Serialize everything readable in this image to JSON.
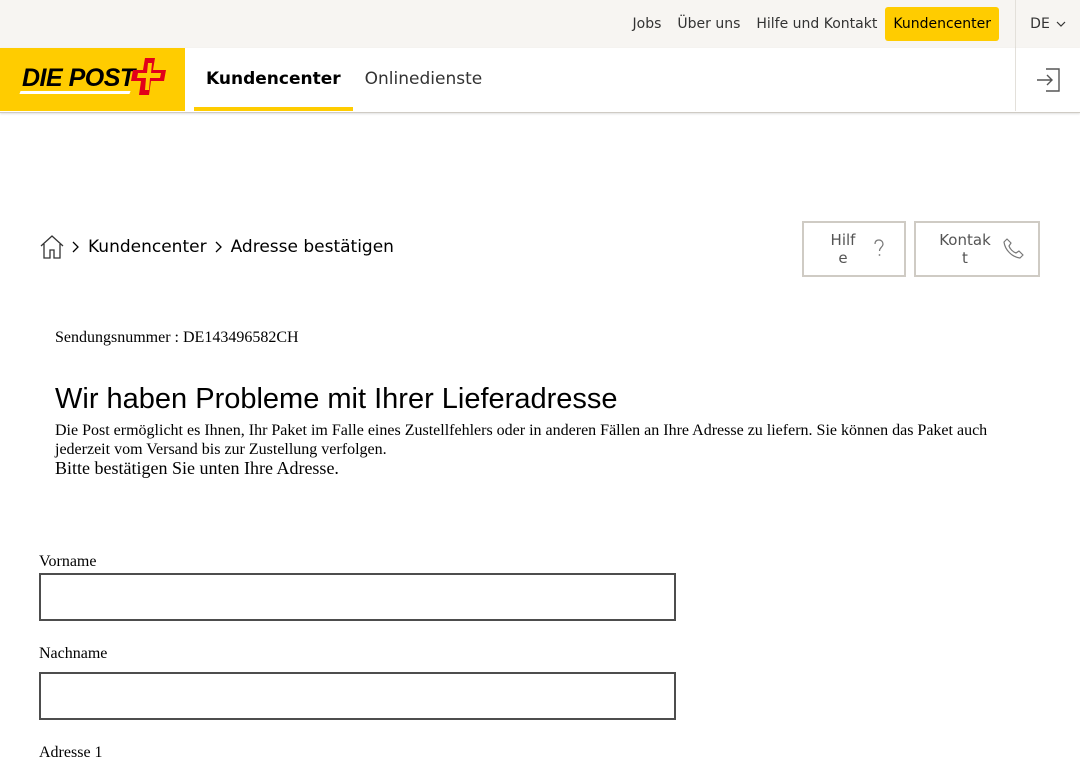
{
  "topbar": {
    "links": [
      "Jobs",
      "Über uns",
      "Hilfe und Kontakt"
    ],
    "active_link": "Kundencenter",
    "language": "DE"
  },
  "brand": {
    "logo_text": "DIE POST",
    "accent": "#ffcc00",
    "cross_color": "#e2001a"
  },
  "mainnav": {
    "items": [
      "Kundencenter",
      "Onlinedienste"
    ],
    "active": "Kundencenter"
  },
  "breadcrumb": {
    "items": [
      "Kundencenter",
      "Adresse bestätigen"
    ]
  },
  "actions": {
    "help_label": "Hilfe",
    "contact_label": "Kontakt"
  },
  "content": {
    "tracking": "Sendungsnummer : DE143496582CH",
    "headline": "Wir haben Probleme mit Ihrer Lieferadresse",
    "intro": "Die Post ermöglicht es Ihnen, Ihr Paket im Falle eines Zustellfehlers oder in anderen Fällen an Ihre Adresse zu liefern. Sie können das Paket auch jederzeit vom Versand bis zur Zustellung verfolgen.",
    "confirm": "Bitte bestätigen Sie unten Ihre Adresse."
  },
  "form": {
    "firstname_label": "Vorname",
    "firstname_value": "",
    "lastname_label": "Nachname",
    "lastname_value": "",
    "address1_label": "Adresse 1"
  }
}
